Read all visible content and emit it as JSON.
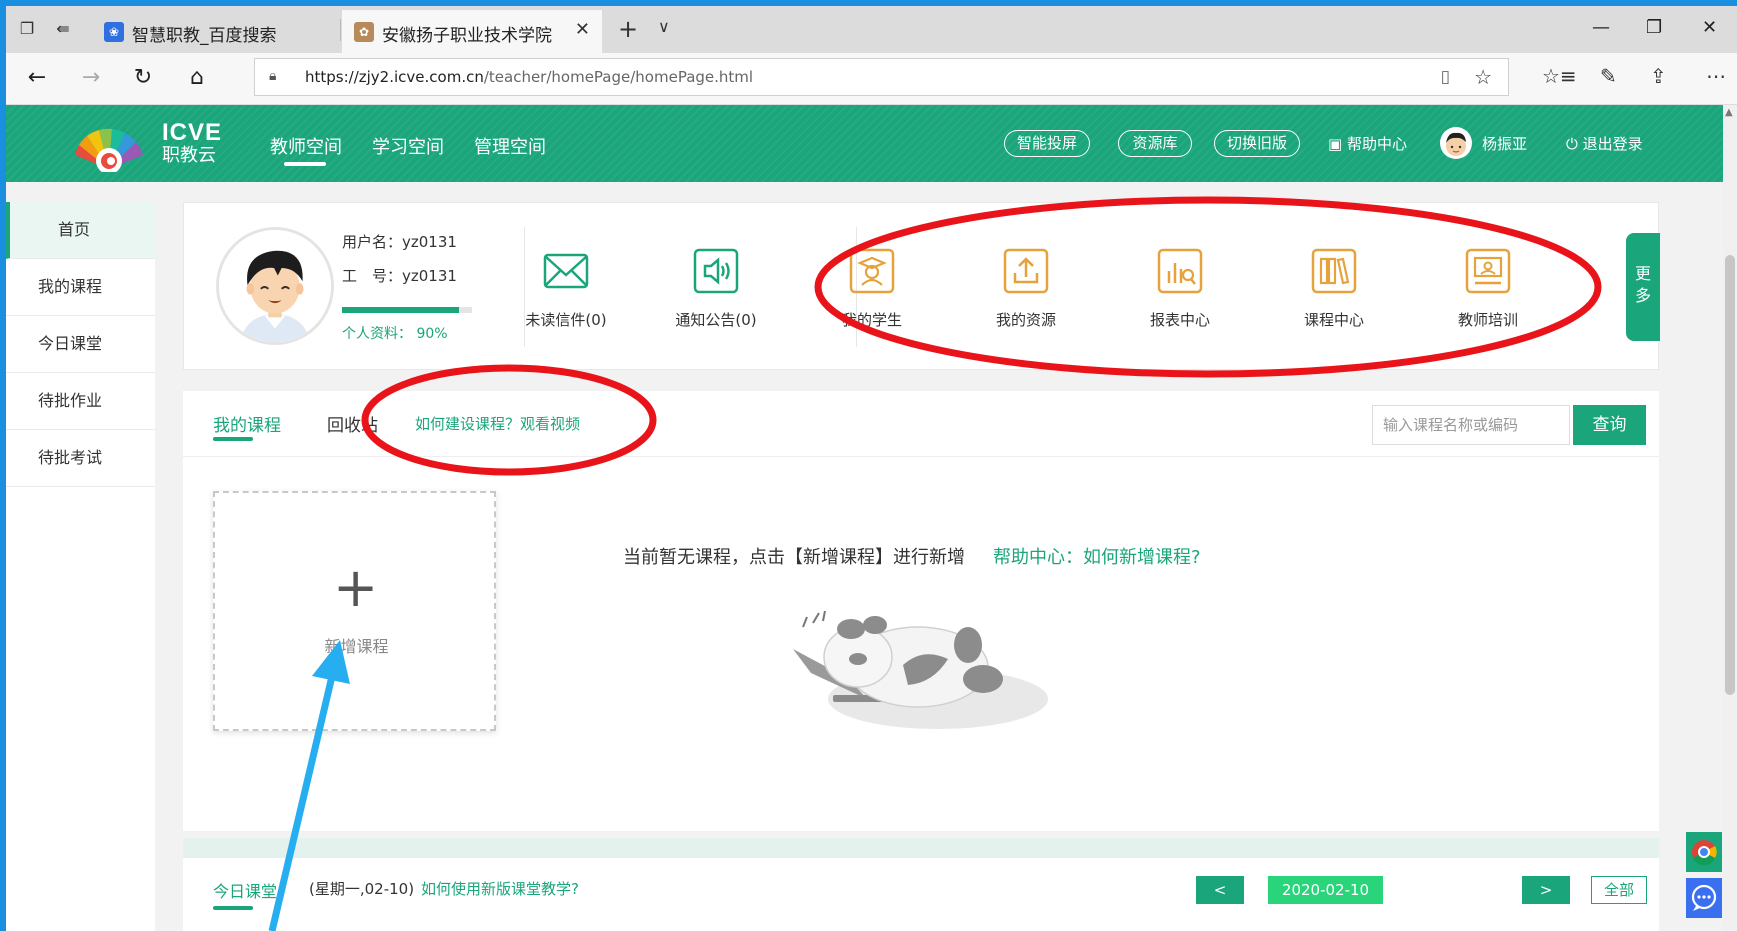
{
  "browser": {
    "tabs": [
      {
        "title": "智慧职教_百度搜索",
        "active": false
      },
      {
        "title": "安徽扬子职业技术学院",
        "active": true
      }
    ],
    "url_host": "https://zjy2.icve.com.cn",
    "url_path": "/teacher/homePage/homePage.html"
  },
  "header": {
    "logo_brand": "ICVE",
    "logo_name": "职教云",
    "nav": [
      "教师空间",
      "学习空间",
      "管理空间"
    ],
    "pills": [
      "智能投屏",
      "资源库",
      "切换旧版"
    ],
    "help": "帮助中心",
    "user": "杨振亚",
    "logout": "退出登录"
  },
  "sidebar": {
    "items": [
      "首页",
      "我的课程",
      "今日课堂",
      "待批作业",
      "待批考试"
    ]
  },
  "profile": {
    "username": "用户名：yz0131",
    "worknum": "工　号：yz0131",
    "completeness_label": "个人资料：  90%",
    "completeness": 0.9
  },
  "quick_links": [
    "未读信件(0)",
    "通知公告(0)",
    "我的学生",
    "我的资源",
    "报表中心",
    "课程中心",
    "教师培训"
  ],
  "more_label": "更多",
  "courses": {
    "tabs": [
      "我的课程",
      "回收站"
    ],
    "help_link": "如何建设课程？观看视频",
    "search_placeholder": "输入课程名称或编码",
    "search_button": "查询",
    "add_course_label": "新增课程",
    "empty_message": "当前暂无课程，点击【新增课程】进行新增",
    "empty_help": "帮助中心：如何新增课程?"
  },
  "today": {
    "label": "今日课堂",
    "date_text": "(星期一,02-10)",
    "help": "如何使用新版课堂教学?",
    "prev": "<",
    "date": "2020-02-10",
    "next": ">",
    "all": "全部"
  },
  "colors": {
    "brand_green": "#1ba57a",
    "annotation_red": "#e8141a",
    "annotation_arrow": "#27aef0"
  }
}
